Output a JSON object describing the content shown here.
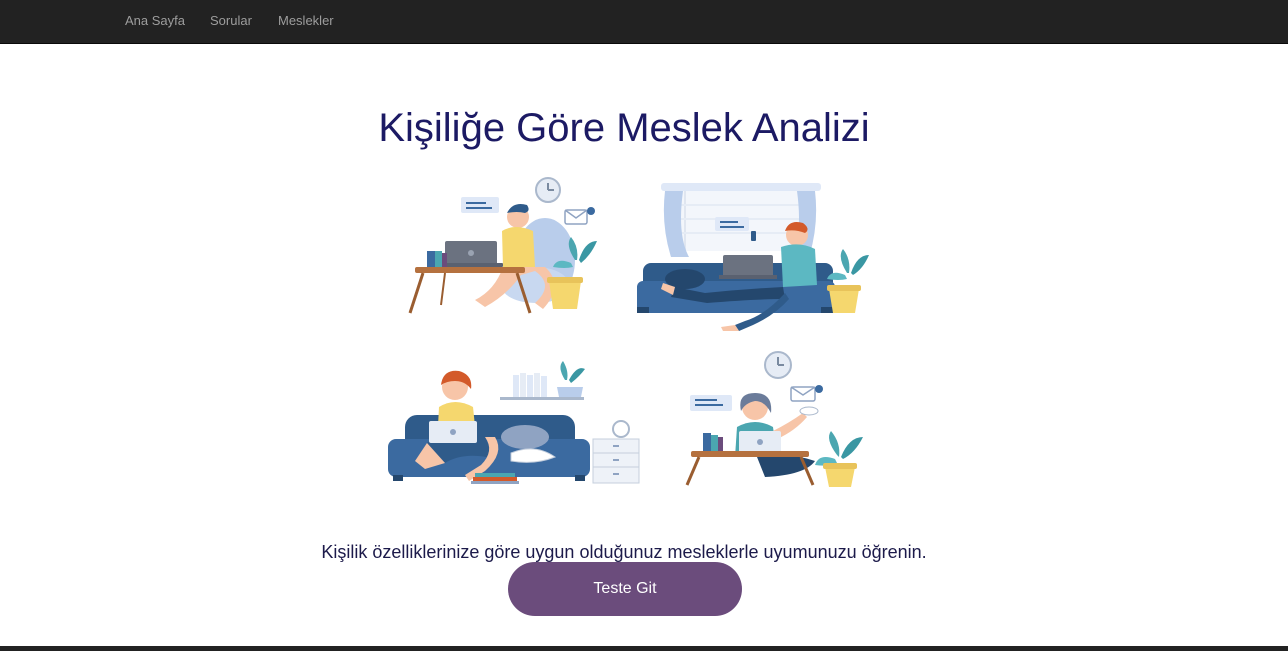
{
  "nav": {
    "items": [
      {
        "label": "Ana Sayfa"
      },
      {
        "label": "Sorular"
      },
      {
        "label": "Meslekler"
      }
    ]
  },
  "hero": {
    "title": "Kişiliğe Göre Meslek Analizi",
    "subtitle": "Kişilik özelliklerinize göre uygun olduğunuz mesleklerle uyumunuzu öğrenin.",
    "cta_label": "Teste Git"
  },
  "illustration": {
    "icon": "remote-work-people-illustration",
    "colors": {
      "dark_blue": "#2f5b8a",
      "sofa_blue": "#3b6aa0",
      "teal": "#4ba6b0",
      "yellow": "#f5d76e",
      "skin": "#f7c5a8",
      "wood": "#b5713f",
      "light": "#dfe8f7"
    }
  },
  "theme": {
    "navbar_bg": "#222222",
    "title_color": "#1c1a64",
    "button_bg": "#6b4c7c"
  }
}
